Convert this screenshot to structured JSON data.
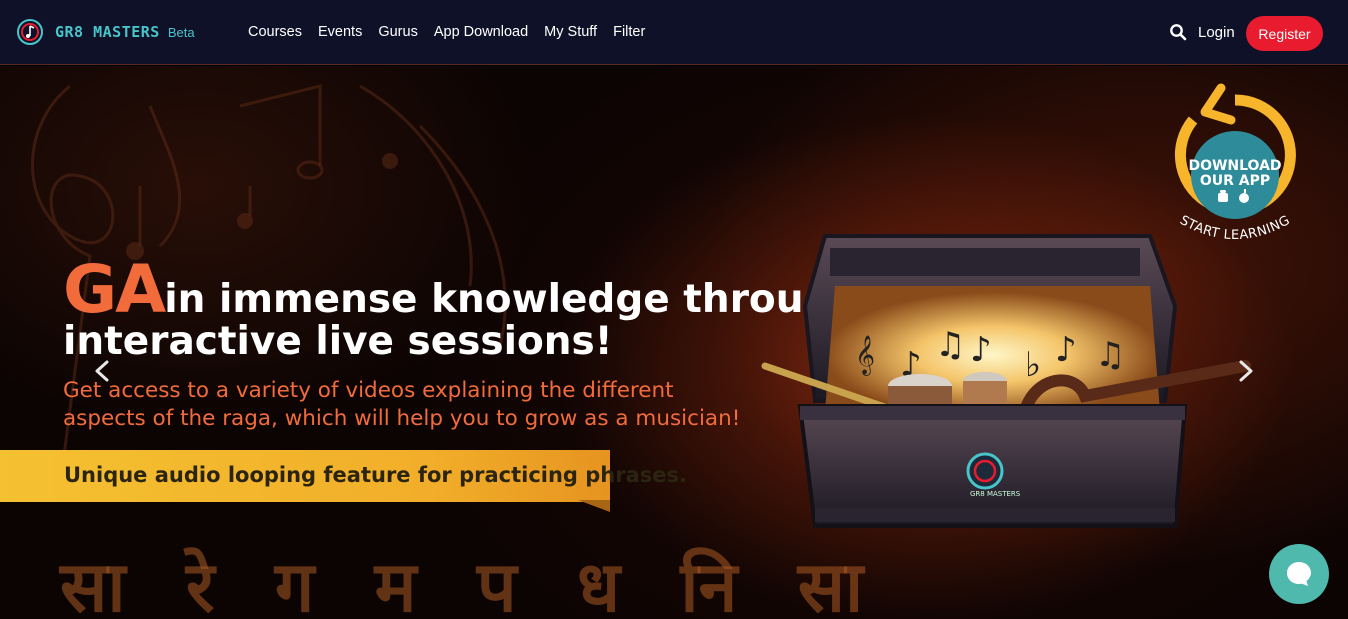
{
  "brand": {
    "name": "GR8 MASTERS",
    "beta": "Beta"
  },
  "nav": {
    "items": [
      "Courses",
      "Events",
      "Gurus",
      "App Download",
      "My Stuff",
      "Filter"
    ]
  },
  "header": {
    "search_icon": "search-icon",
    "login": "Login",
    "register": "Register"
  },
  "hero": {
    "headline_highlight": "GA",
    "headline_rest": "in immense knowledge through",
    "headline_line2": "interactive live sessions!",
    "subtext": "Get access to a variety of videos explaining the different aspects of the raga, which will help you to grow as a musician!",
    "ribbon": "Unique audio looping feature for practicing phrases.",
    "swaras": "सा रे ग म प ध नि सा"
  },
  "app_badge": {
    "line1": "DOWNLOAD",
    "line2": "OUR APP",
    "arc_text": "START LEARNING"
  },
  "chest_logo_text": "GR8 MASTERS",
  "colors": {
    "nav_bg": "#0f1129",
    "accent_orange": "#f26b3a",
    "register_red": "#e81c2e",
    "brand_teal": "#48c5c9",
    "ribbon_yellow": "#f4c131",
    "badge_teal": "#2e8c9a",
    "badge_yellow": "#f6b52a",
    "chat_teal": "#4fb9ad"
  }
}
